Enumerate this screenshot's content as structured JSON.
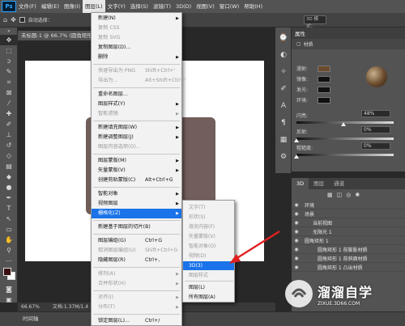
{
  "menubar": {
    "logo": "Ps",
    "items": [
      "文件(F)",
      "编辑(E)",
      "图像(I)",
      "图层(L)",
      "文字(Y)",
      "选择(S)",
      "滤镜(T)",
      "3D(D)",
      "视图(V)",
      "窗口(W)",
      "帮助(H)"
    ],
    "active_index": 3
  },
  "optionsbar": {
    "auto_select": "自动选择：",
    "mode": "3D 模式："
  },
  "document": {
    "tab_title": "未标题-1 @ 66.7% (圆角矩形 1",
    "zoom": "66.67%",
    "doc_info": "文档:1.37M/1.4",
    "colors": {
      "rect": "#725e5b",
      "canvas": "#ffffff"
    }
  },
  "timeline": {
    "label": "时间轴"
  },
  "properties": {
    "title": "属性",
    "subtab": "材质",
    "materials": [
      "漫射:",
      "镜像:",
      "发光:",
      "环境:"
    ],
    "sliders": [
      {
        "label": "闪亮:",
        "value": "48%",
        "level": 0.48
      },
      {
        "label": "反射:",
        "value": "0%",
        "level": 0
      },
      {
        "label": "粗糙度:",
        "value": "0%",
        "level": 0
      }
    ]
  },
  "layers": {
    "tabs": [
      "3D",
      "图层",
      "通道"
    ],
    "items": [
      "环境",
      "场景",
      "当前视图",
      "无限光 1",
      "圆角矩形 1",
      "圆角矩形 1 前膨胀材质",
      "圆角矩形 1 前斜面材质",
      "圆角矩形 1 凸出材质"
    ]
  },
  "dropdown": {
    "items": [
      {
        "label": "新建(N)",
        "arrow": true
      },
      {
        "label": "复制 CSS",
        "disabled": true
      },
      {
        "label": "复制 SVG",
        "disabled": true
      },
      {
        "label": "复制图层(D)..."
      },
      {
        "label": "删除",
        "arrow": true
      },
      {
        "label": "快速导出为 PNG",
        "shortcut": "Shift+Ctrl+'",
        "disabled": true
      },
      {
        "label": "导出为...",
        "shortcut": "Alt+Shift+Ctrl+'",
        "disabled": true
      },
      {
        "label": "重命名图层..."
      },
      {
        "label": "图层样式(Y)",
        "arrow": true
      },
      {
        "label": "智能滤镜",
        "arrow": true,
        "disabled": true
      },
      {
        "label": "新建填充图层(W)",
        "arrow": true
      },
      {
        "label": "新建调整图层(J)",
        "arrow": true
      },
      {
        "label": "图层内容选项(O)...",
        "disabled": true
      },
      {
        "label": "图层蒙版(M)",
        "arrow": true
      },
      {
        "label": "矢量蒙版(V)",
        "arrow": true
      },
      {
        "label": "创建剪贴蒙版(C)",
        "shortcut": "Alt+Ctrl+G"
      },
      {
        "label": "智能对象",
        "arrow": true
      },
      {
        "label": "视频图层",
        "arrow": true
      },
      {
        "label": "栅格化(Z)",
        "arrow": true,
        "highlight": true
      },
      {
        "label": "新建基于图层的切片(B)"
      },
      {
        "label": "图层编组(G)",
        "shortcut": "Ctrl+G"
      },
      {
        "label": "取消图层编组(U)",
        "shortcut": "Shift+Ctrl+G",
        "disabled": true
      },
      {
        "label": "隐藏图层(R)",
        "shortcut": "Ctrl+,"
      },
      {
        "label": "排列(A)",
        "arrow": true,
        "disabled": true
      },
      {
        "label": "合并形状(H)",
        "arrow": true,
        "disabled": true
      },
      {
        "label": "对齐(I)",
        "arrow": true,
        "disabled": true
      },
      {
        "label": "分布(T)",
        "arrow": true,
        "disabled": true
      },
      {
        "label": "锁定图层(L)...",
        "shortcut": "Ctrl+/"
      }
    ]
  },
  "submenu": {
    "items": [
      {
        "label": "文字(T)",
        "disabled": true
      },
      {
        "label": "形状(S)",
        "disabled": true
      },
      {
        "label": "填充内容(F)",
        "disabled": true
      },
      {
        "label": "矢量蒙版(V)",
        "disabled": true
      },
      {
        "label": "智能对象(O)",
        "disabled": true
      },
      {
        "label": "视频(D)",
        "disabled": true
      },
      {
        "label": "3D(3)",
        "highlight": true
      },
      {
        "label": "图层样式",
        "disabled": true
      },
      {
        "label": "图层(L)"
      },
      {
        "label": "所有图层(A)"
      }
    ]
  },
  "watermark": {
    "brand": "溜溜自学",
    "url": "ZIXUE.3D66.COM"
  },
  "accent": {
    "highlight": "#1a73e8",
    "arrow": "#e02020"
  }
}
